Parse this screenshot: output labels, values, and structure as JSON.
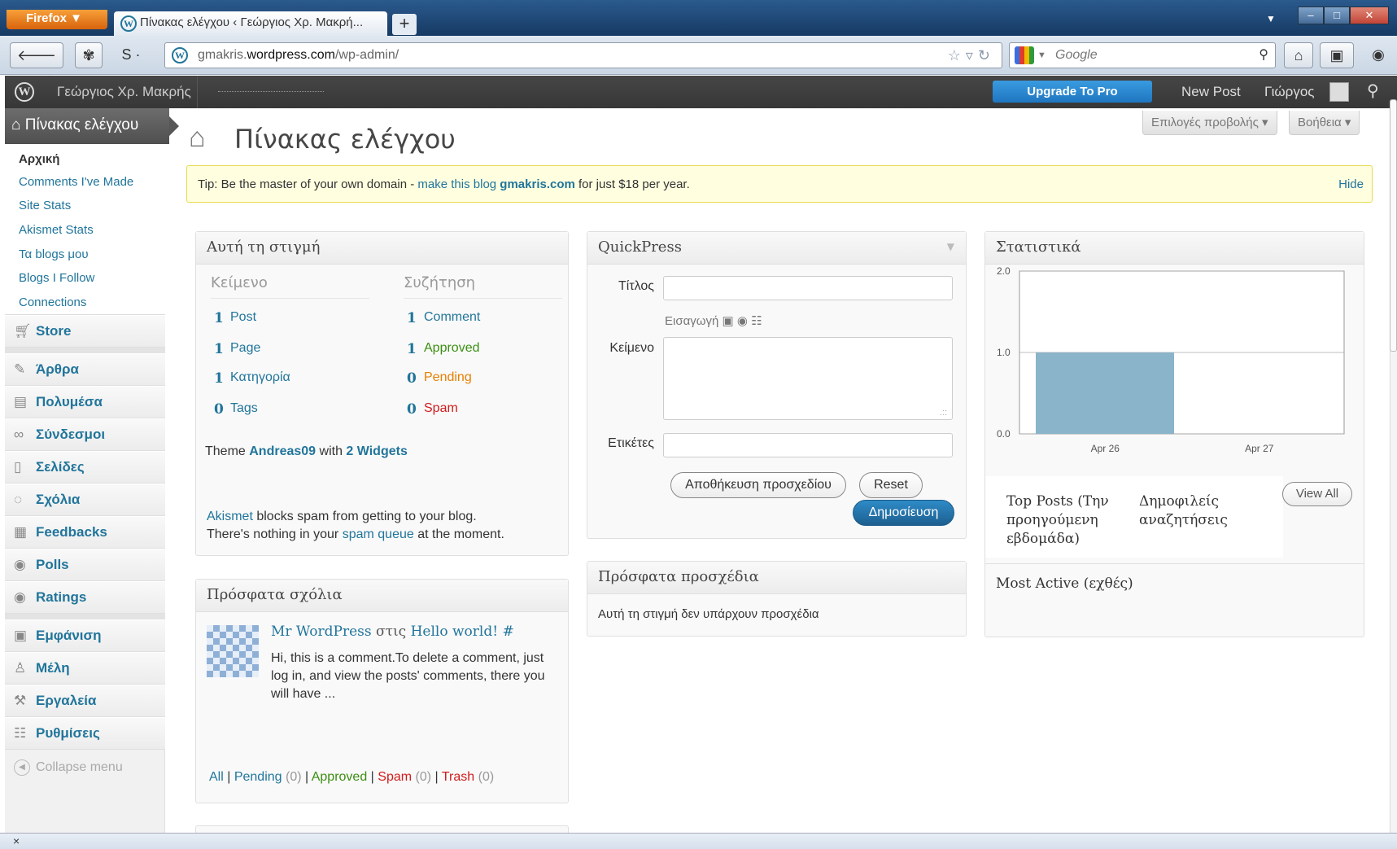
{
  "browser": {
    "menu_button": "Firefox",
    "tab_title": "Πίνακας ελέγχου ‹ Γεώργιος Χρ. Μακρή...",
    "url_prefix": "gmakris.",
    "url_domain": "wordpress.com",
    "url_path": "/wp-admin/",
    "search_placeholder": "Google",
    "status_close": "×"
  },
  "adminbar": {
    "site_name": "Γεώργιος Χρ. Μακρής",
    "upgrade": "Upgrade To Pro",
    "new_post": "New Post",
    "user": "Γιώργος"
  },
  "sidebar": {
    "dashboard": "Πίνακας ελέγχου",
    "submenu": [
      "Αρχική",
      "Comments I've Made",
      "Site Stats",
      "Akismet Stats",
      "Τα blogs μου",
      "Blogs I Follow",
      "Connections"
    ],
    "store": "Store",
    "group1": [
      "Άρθρα",
      "Πολυμέσα",
      "Σύνδεσμοι",
      "Σελίδες",
      "Σχόλια",
      "Feedbacks",
      "Polls",
      "Ratings"
    ],
    "group2": [
      "Εμφάνιση",
      "Μέλη",
      "Εργαλεία",
      "Ρυθμίσεις"
    ],
    "collapse": "Collapse menu"
  },
  "page": {
    "title": "Πίνακας ελέγχου",
    "screen_options": "Επιλογές προβολής",
    "help": "Βοήθεια"
  },
  "tip": {
    "prefix": "Tip: Be the master of your own domain - ",
    "link": "make this blog",
    "domain": "gmakris.com",
    "suffix": " for just $18 per year.",
    "hide": "Hide"
  },
  "right_now": {
    "title": "Αυτή τη στιγμή",
    "col_content": "Κείμενο",
    "col_discussion": "Συζήτηση",
    "content": [
      [
        "1",
        "Post"
      ],
      [
        "1",
        "Page"
      ],
      [
        "1",
        "Κατηγορία"
      ],
      [
        "0",
        "Tags"
      ]
    ],
    "discussion": [
      [
        "1",
        "Comment"
      ],
      [
        "1",
        "Approved"
      ],
      [
        "0",
        "Pending"
      ],
      [
        "0",
        "Spam"
      ]
    ],
    "theme_prefix": "Theme ",
    "theme_name": "Andreas09",
    "theme_with": " with ",
    "widgets": "2 Widgets",
    "akismet": "Akismet",
    "akismet_text": " blocks spam from getting to your blog.",
    "spam_line_prefix": "There's nothing in your ",
    "spam_queue": "spam queue",
    "spam_line_suffix": " at the moment."
  },
  "recent_comments": {
    "title": "Πρόσφατα σχόλια",
    "author": "Mr WordPress",
    "on": " στις ",
    "post": "Hello world!",
    "hash": " #",
    "excerpt": "Hi, this is a comment.To delete a comment, just log in, and view the posts' comments, there you will have ...",
    "filters": {
      "all": "All",
      "pending": "Pending",
      "pending_count": "(0)",
      "approved": "Approved",
      "spam": "Spam",
      "spam_count": "(0)",
      "trash": "Trash",
      "trash_count": "(0)"
    }
  },
  "quickpress": {
    "title": "QuickPress",
    "title_label": "Τίτλος",
    "insert_label": "Εισαγωγή",
    "content_label": "Κείμενο",
    "tags_label": "Ετικέτες",
    "save_draft": "Αποθήκευση προσχεδίου",
    "reset": "Reset",
    "publish": "Δημοσίευση"
  },
  "recent_drafts": {
    "title": "Πρόσφατα προσχέδια",
    "empty": "Αυτή τη στιγμή δεν υπάρχουν προσχέδια"
  },
  "stats": {
    "title": "Στατιστικά",
    "top_posts": "Top Posts (Την προηγούμενη εβδομάδα)",
    "top_searches": "Δημοφιλείς αναζητήσεις",
    "view_all": "View All",
    "most_active": "Most Active (εχθές)"
  },
  "chart_data": {
    "type": "bar",
    "categories": [
      "Apr 26",
      "Apr 27"
    ],
    "values": [
      1,
      0
    ],
    "ylim": [
      0,
      2
    ],
    "yticks": [
      "0.0",
      "1.0",
      "2.0"
    ],
    "bar_color": "#8ab4c9",
    "grid": true
  }
}
